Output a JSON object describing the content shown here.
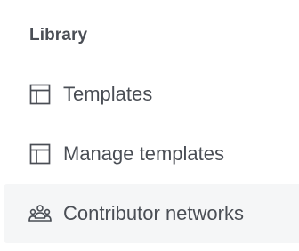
{
  "library": {
    "title": "Library",
    "items": [
      {
        "label": "Templates",
        "icon": "template-layout-icon",
        "active": false
      },
      {
        "label": "Manage templates",
        "icon": "template-layout-icon",
        "active": false
      },
      {
        "label": "Contributor networks",
        "icon": "people-group-icon",
        "active": true
      }
    ]
  },
  "colors": {
    "text": "#4a4e55",
    "active_background": "#f5f6f7",
    "background": "#ffffff"
  }
}
